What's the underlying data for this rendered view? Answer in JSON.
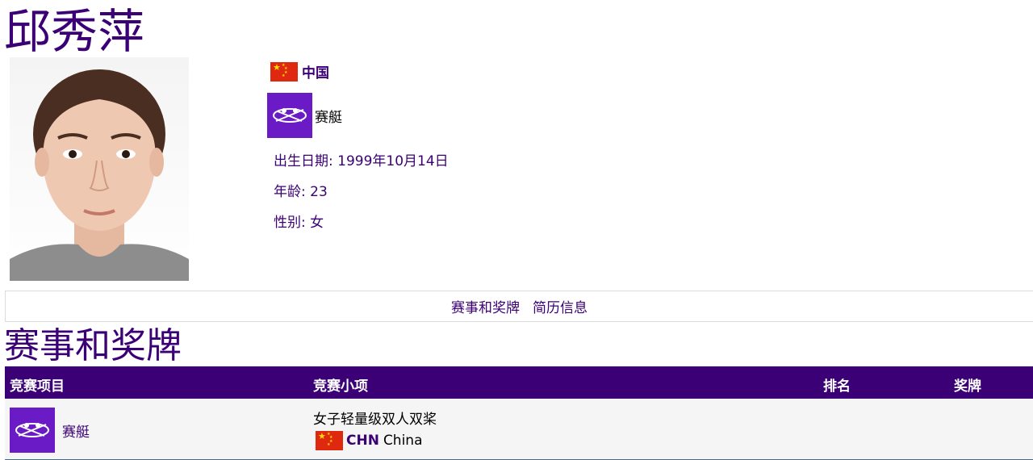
{
  "athlete": {
    "name": "邱秀萍",
    "noc": "中国",
    "sport": "赛艇",
    "birth_label": "出生日期",
    "birth_value": "1999年10月14日",
    "age_label": "年龄",
    "age_value": "23",
    "gender_label": "性别",
    "gender_value": "女"
  },
  "tabs": [
    {
      "label": "赛事和奖牌"
    },
    {
      "label": "简历信息"
    }
  ],
  "section": {
    "title": "赛事和奖牌"
  },
  "table": {
    "headers": {
      "sport": "竞赛项目",
      "event": "竞赛小项",
      "rank": "排名",
      "medal": "奖牌"
    },
    "rows": [
      {
        "sport": "赛艇",
        "event": "女子轻量级双人双桨",
        "noc_code": "CHN",
        "country": "China",
        "rank": "",
        "medal": ""
      }
    ]
  },
  "colors": {
    "brand": "#3b0075",
    "sport_pictogram": "#6a1bc5",
    "flag_red": "#de2910",
    "flag_star": "#ffde00"
  },
  "icons": {
    "flag": "china-flag-icon",
    "sport": "rowing-pictogram-icon",
    "photo": "athlete-photo"
  }
}
